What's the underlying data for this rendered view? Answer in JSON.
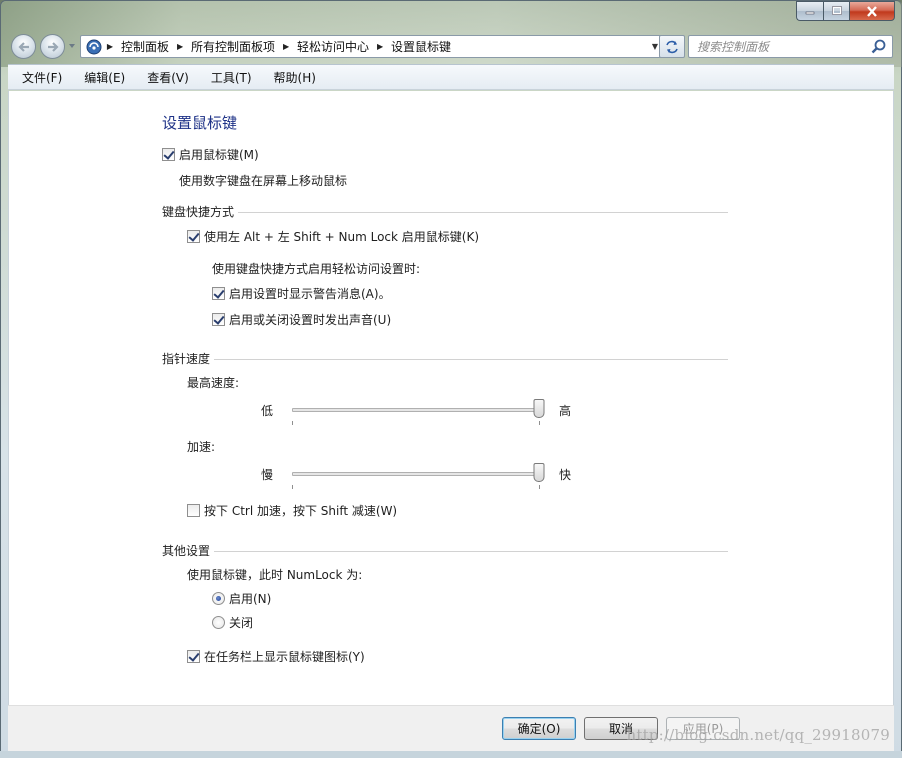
{
  "window": {
    "caption_buttons": [
      "minimize",
      "maximize",
      "close"
    ]
  },
  "nav": {
    "back_icon": "back-arrow-icon",
    "forward_icon": "forward-arrow-icon",
    "breadcrumbs": [
      "控制面板",
      "所有控制面板项",
      "轻松访问中心",
      "设置鼠标键"
    ],
    "search_placeholder": "搜索控制面板"
  },
  "menubar": {
    "items": [
      "文件(F)",
      "编辑(E)",
      "查看(V)",
      "工具(T)",
      "帮助(H)"
    ]
  },
  "page": {
    "title": "设置鼠标键",
    "enable_mouse_keys": {
      "label": "启用鼠标键(M)",
      "checked": true
    },
    "enable_desc": "使用数字键盘在屏幕上移动鼠标",
    "keyboard_shortcut": {
      "heading": "键盘快捷方式",
      "shortcut_option": {
        "label": "使用左 Alt + 左 Shift + Num Lock 启用鼠标键(K)",
        "checked": true
      },
      "when_using": "使用键盘快捷方式启用轻松访问设置时:",
      "warning_option": {
        "label": "启用设置时显示警告消息(A)。",
        "checked": true
      },
      "sound_option": {
        "label": "启用或关闭设置时发出声音(U)",
        "checked": true
      }
    },
    "pointer_speed": {
      "heading": "指针速度",
      "top_speed_label": "最高速度:",
      "top_speed": {
        "low": "低",
        "high": "高",
        "value": 1.0
      },
      "acceleration_label": "加速:",
      "acceleration": {
        "low": "慢",
        "high": "快",
        "value": 1.0
      },
      "ctrl_shift_option": {
        "label": "按下 Ctrl 加速，按下 Shift 减速(W)",
        "checked": false
      }
    },
    "other": {
      "heading": "其他设置",
      "numlock_label": "使用鼠标键，此时 NumLock 为:",
      "radio_on": {
        "label": "启用(N)",
        "checked": true
      },
      "radio_off": {
        "label": "关闭",
        "checked": false
      },
      "taskbar_option": {
        "label": "在任务栏上显示鼠标键图标(Y)",
        "checked": true
      }
    }
  },
  "footer": {
    "ok": "确定(O)",
    "cancel": "取消",
    "apply": "应用(P)"
  },
  "watermark": "http://blog.csdn.net/qq_29918079",
  "colors": {
    "title": "#1e3287",
    "close_button": "#c0391d"
  }
}
